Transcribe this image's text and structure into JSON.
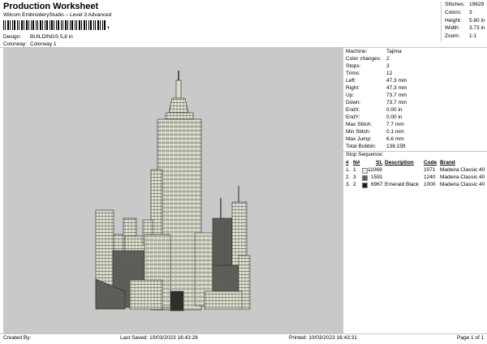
{
  "header": {
    "title": "Production Worksheet",
    "subtitle": "Wilcom EmbroideryStudio – Level 3 Advanced",
    "barcode_suffix": ","
  },
  "design_info": {
    "design_label": "Design:",
    "design_value": "BUILDINGS 5,8 in",
    "colorway_label": "Colorway:",
    "colorway_value": "Colorway 1"
  },
  "top_stats": [
    {
      "label": "Stitches:",
      "value": "19629"
    },
    {
      "label": "Colors:",
      "value": "3"
    },
    {
      "label": "Height:",
      "value": "5.80 in"
    },
    {
      "label": "Width:",
      "value": "3.73 in"
    },
    {
      "label": "Zoom:",
      "value": "1:1"
    }
  ],
  "machine_info": [
    {
      "label": "Machine:",
      "value": "Tajima"
    },
    {
      "label": "Color changes:",
      "value": "2"
    },
    {
      "label": "Stops:",
      "value": "3"
    },
    {
      "label": "Trims:",
      "value": "12"
    },
    {
      "label": "Left:",
      "value": "47.3 mm"
    },
    {
      "label": "Right:",
      "value": "47.3 mm"
    },
    {
      "label": "Up:",
      "value": "73.7 mm"
    },
    {
      "label": "Down:",
      "value": "73.7 mm"
    },
    {
      "label": "EndX:",
      "value": "0.00 in"
    },
    {
      "label": "EndY:",
      "value": "0.00 in"
    },
    {
      "label": "Max Stitch:",
      "value": "7.7 mm"
    },
    {
      "label": "Min Stitch:",
      "value": "0.1 mm"
    },
    {
      "label": "Max Jump:",
      "value": "6.6 mm"
    },
    {
      "label": "Total Bobbin:",
      "value": "138.15ft"
    }
  ],
  "stop_sequence": {
    "title": "Stop Sequence:",
    "headers": {
      "num": "#",
      "n": "N#",
      "st": "St.",
      "description": "Description",
      "code": "Code",
      "brand": "Brand"
    },
    "rows": [
      {
        "num": "1.",
        "n": "1",
        "color": "#e8ecdc",
        "st": "11069",
        "description": "",
        "code": "1071",
        "brand": "Madeira Classic 40"
      },
      {
        "num": "2.",
        "n": "3",
        "color": "#5e5e58",
        "st": "1591",
        "description": "",
        "code": "1240",
        "brand": "Madeira Classic 40"
      },
      {
        "num": "3.",
        "n": "2",
        "color": "#1c1c1c",
        "st": "6967",
        "description": "Emerald Black",
        "code": "1000",
        "brand": "Madeira Classic 40"
      }
    ]
  },
  "footer": {
    "created_by": "Created By:",
    "last_saved": "Last Saved: 10/03/2023 16:43:28",
    "printed": "Printed: 10/03/2023 16:43:31",
    "page": "Page 1 of 1"
  },
  "colors": {
    "canvas_bg": "#c9c9c9",
    "thread_light": "#e8ecdc",
    "thread_mid": "#5e5e58",
    "thread_dark": "#1c1c1c"
  }
}
